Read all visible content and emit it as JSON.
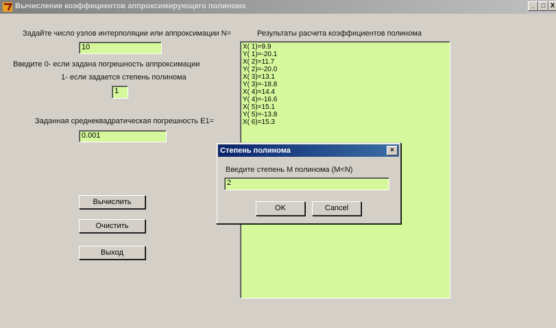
{
  "window": {
    "title": "Вычисление коэффициентов аппроксимирующего полинома",
    "minimize": "_",
    "maximize": "□",
    "close": "X"
  },
  "form": {
    "n_label": "Задайте число узлов интерполяции или аппроксимации N=",
    "n_value": "10",
    "mode_label_1": "Введите 0- если задана погрешность аппроксимации",
    "mode_label_2": "1- если задается степень полинома",
    "mode_value": "1",
    "error_label": "Заданная среднеквадратическая погрешность Е1=",
    "error_value": "0.001"
  },
  "buttons": {
    "calculate": "Вычислить",
    "clear": "Очистить",
    "exit": "Выход"
  },
  "results": {
    "label": "Результаты расчета коэффициентов полинома",
    "lines": [
      "X( 1)=9.9",
      "Y( 1)=-20.1",
      "X( 2)=11.7",
      "Y( 2)=-20.0",
      "X( 3)=13.1",
      "Y( 3)=-18.8",
      "X( 4)=14.4",
      "Y( 4)=-16.6",
      "X( 5)=15.1",
      "Y( 5)=-13.8",
      "X( 6)=15.3"
    ]
  },
  "dialog": {
    "title": "Степень полинома",
    "close": "×",
    "prompt": "Введите степень М полинома (M<N)",
    "value": "2",
    "ok": "OK",
    "cancel": "Cancel"
  }
}
